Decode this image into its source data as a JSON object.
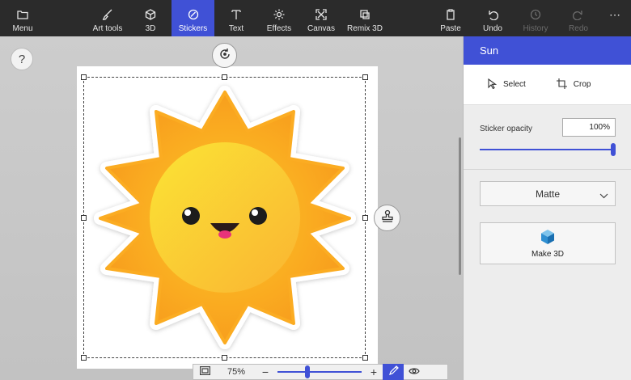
{
  "toolbar": {
    "menu": "Menu",
    "art_tools": "Art tools",
    "three_d": "3D",
    "stickers": "Stickers",
    "text": "Text",
    "effects": "Effects",
    "canvas": "Canvas",
    "remix_3d": "Remix 3D",
    "paste": "Paste",
    "undo": "Undo",
    "history": "History",
    "redo": "Redo",
    "more": "⋯",
    "active_color": "#4051d6"
  },
  "canvas": {
    "help": "?",
    "sticker_name": "sun-sticker"
  },
  "zoom": {
    "value": "75%",
    "minus": "−",
    "plus": "+",
    "level_fraction": 0.36
  },
  "panel": {
    "title": "Sun",
    "select": "Select",
    "crop": "Crop",
    "opacity_label": "Sticker opacity",
    "opacity_value": "100%",
    "finish": "Matte",
    "make3d": "Make 3D"
  }
}
